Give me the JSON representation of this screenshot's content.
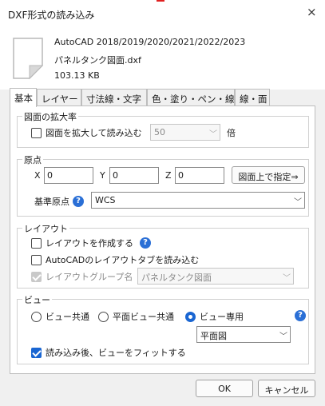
{
  "window": {
    "title": "DXF形式の読み込み",
    "close_icon": "×"
  },
  "file": {
    "version": "AutoCAD 2018/2019/2020/2021/2022/2023",
    "name": "パネルタンク図面.dxf",
    "size": "103.13 KB"
  },
  "tabs": [
    {
      "label": "基本",
      "active": true
    },
    {
      "label": "レイヤー"
    },
    {
      "label": "寸法線・文字"
    },
    {
      "label": "色・塗り・ペン・線種"
    },
    {
      "label": "線・面"
    }
  ],
  "scale": {
    "group_title": "図面の拡大率",
    "checkbox_label": "図面を拡大して読み込む",
    "checked": false,
    "value": "50",
    "unit": "倍"
  },
  "origin": {
    "group_title": "原点",
    "x_label": "X",
    "x_value": "0",
    "y_label": "Y",
    "y_value": "0",
    "z_label": "Z",
    "z_value": "0",
    "pick_button": "図面上で指定⇒",
    "base_label": "基準原点",
    "base_value": "WCS"
  },
  "layout": {
    "group_title": "レイアウト",
    "create_label": "レイアウトを作成する",
    "read_tabs_label": "AutoCADのレイアウトタブを読み込む",
    "group_name_label": "レイアウトグループ名",
    "group_name_value": "パネルタンク図面"
  },
  "view": {
    "group_title": "ビュー",
    "radios": [
      {
        "label": "ビュー共通",
        "checked": false
      },
      {
        "label": "平面ビュー共通",
        "checked": false
      },
      {
        "label": "ビュー専用",
        "checked": true
      }
    ],
    "view_select": "平面図",
    "fit_label": "読み込み後、ビューをフィットする",
    "fit_checked": true
  },
  "footer": {
    "ok": "OK",
    "cancel": "キャンセル"
  },
  "colors": {
    "accent": "#1a66d2",
    "help": "#2a6fd6"
  }
}
